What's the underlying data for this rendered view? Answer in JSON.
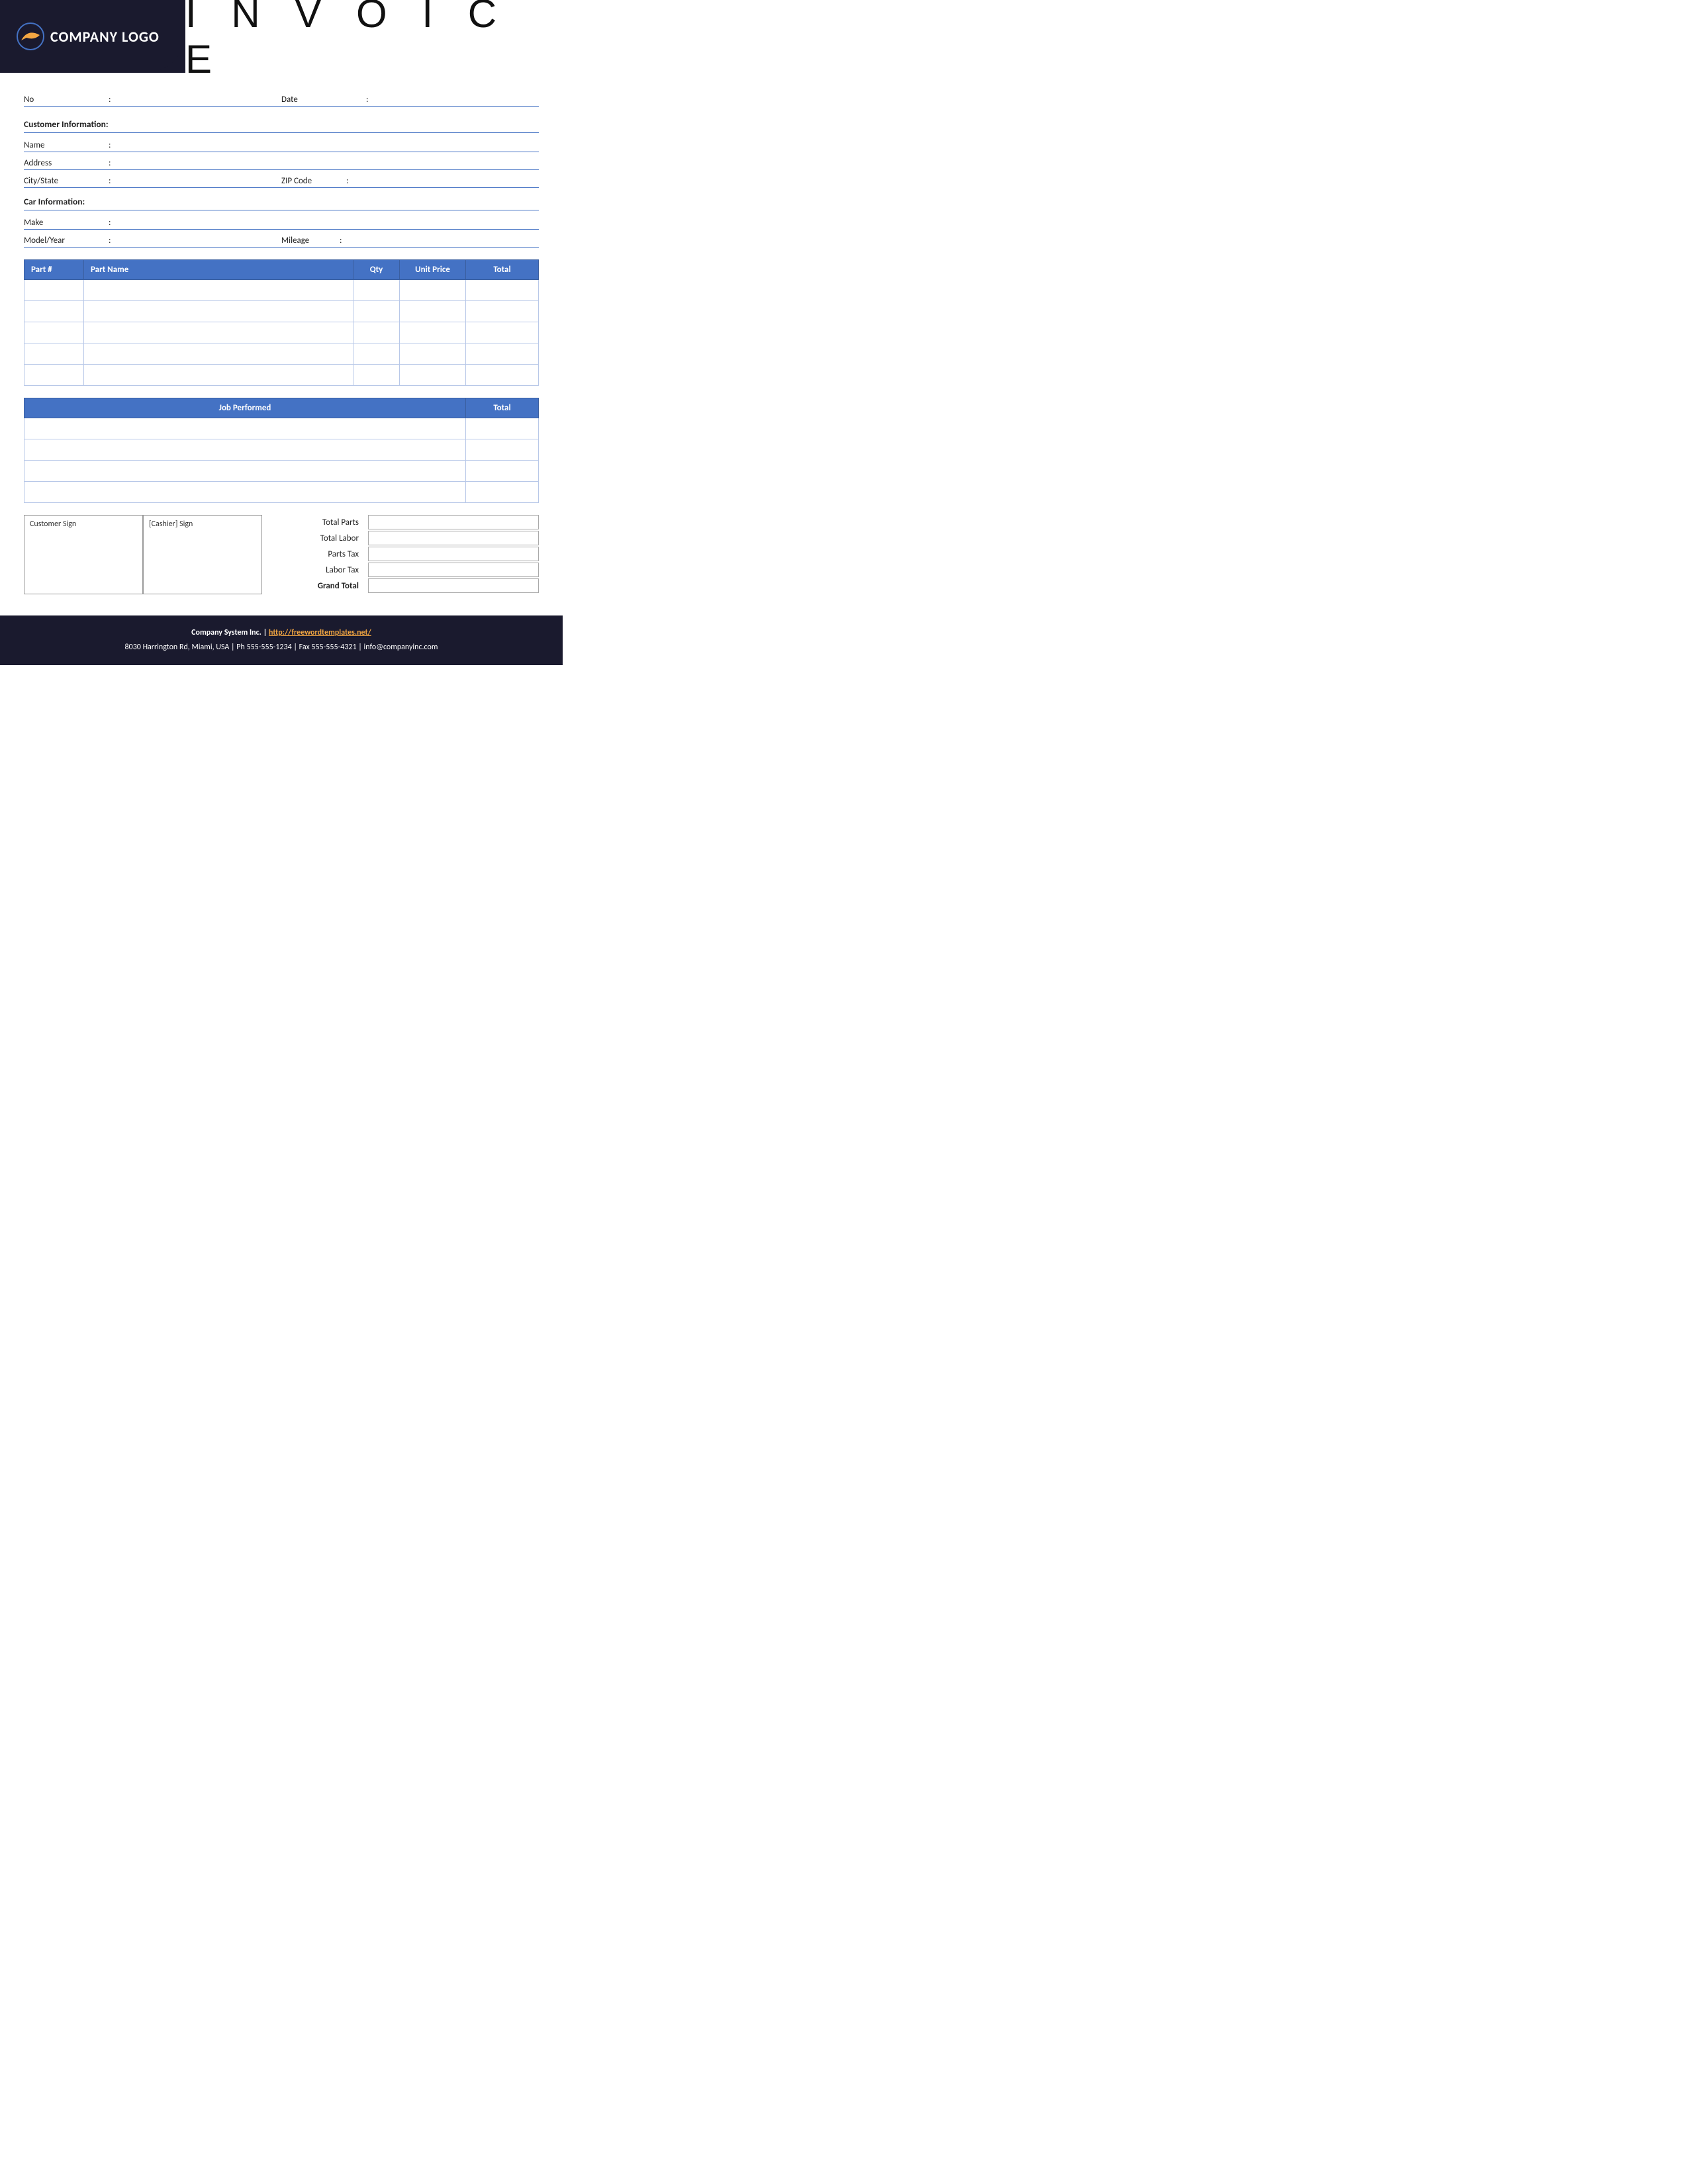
{
  "header": {
    "logo_text": "COMPANY LOGO",
    "invoice_title": "I N V O I C E"
  },
  "form": {
    "no_label": "No",
    "date_label": "Date",
    "colon": ":"
  },
  "customer": {
    "section_title": "Customer Information:",
    "name_label": "Name",
    "address_label": "Address",
    "city_state_label": "City/State",
    "zip_label": "ZIP Code"
  },
  "car": {
    "section_title": "Car Information:",
    "make_label": "Make",
    "model_year_label": "Model/Year",
    "mileage_label": "Mileage"
  },
  "parts_table": {
    "headers": [
      "Part #",
      "Part Name",
      "Qty",
      "Unit Price",
      "Total"
    ],
    "rows": [
      {
        "part_num": "",
        "part_name": "",
        "qty": "",
        "unit_price": "",
        "total": ""
      },
      {
        "part_num": "",
        "part_name": "",
        "qty": "",
        "unit_price": "",
        "total": ""
      },
      {
        "part_num": "",
        "part_name": "",
        "qty": "",
        "unit_price": "",
        "total": ""
      },
      {
        "part_num": "",
        "part_name": "",
        "qty": "",
        "unit_price": "",
        "total": ""
      },
      {
        "part_num": "",
        "part_name": "",
        "qty": "",
        "unit_price": "",
        "total": ""
      }
    ]
  },
  "job_table": {
    "headers": [
      "Job Performed",
      "Total"
    ],
    "rows": [
      {
        "job": "",
        "total": ""
      },
      {
        "job": "",
        "total": ""
      },
      {
        "job": "",
        "total": ""
      },
      {
        "job": "",
        "total": ""
      }
    ]
  },
  "sign": {
    "customer_sign": "Customer Sign",
    "cashier_sign": "[Cashier] Sign"
  },
  "totals": {
    "total_parts_label": "Total Parts",
    "total_labor_label": "Total Labor",
    "parts_tax_label": "Parts Tax",
    "labor_tax_label": "Labor Tax",
    "grand_total_label": "Grand Total"
  },
  "footer": {
    "company_name": "Company System Inc.",
    "separator": "|",
    "website_label": "http://freewordtemplates.net/",
    "address_line": "8030 Harrington Rd, Miami, USA | Ph 555-555-1234 | Fax 555-555-4321 | info@companyinc.com"
  }
}
